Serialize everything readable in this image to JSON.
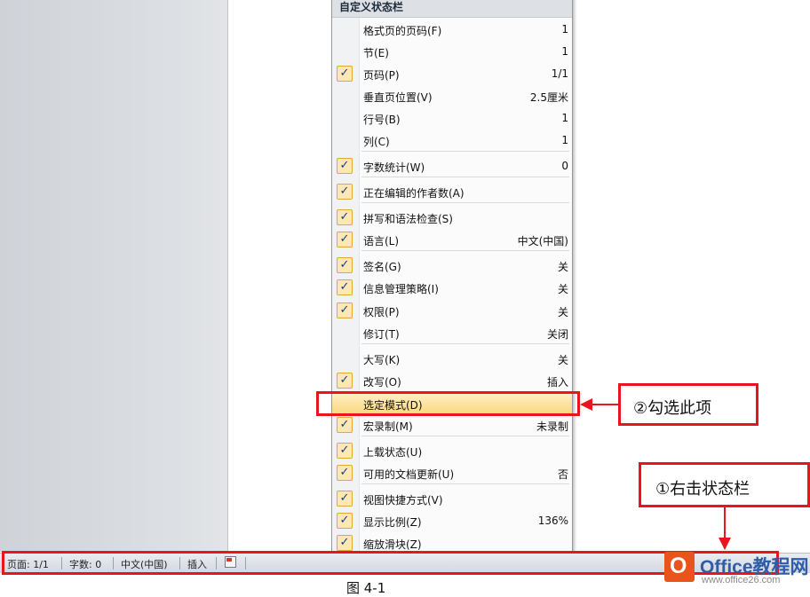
{
  "menu": {
    "title": "自定义状态栏",
    "items": [
      {
        "label": "格式页的页码(F)",
        "value": "1",
        "checked": false
      },
      {
        "label": "节(E)",
        "value": "1",
        "checked": false
      },
      {
        "label": "页码(P)",
        "value": "1/1",
        "checked": true
      },
      {
        "label": "垂直页位置(V)",
        "value": "2.5厘米",
        "checked": false
      },
      {
        "label": "行号(B)",
        "value": "1",
        "checked": false
      },
      {
        "label": "列(C)",
        "value": "1",
        "checked": false
      },
      {
        "label": "字数统计(W)",
        "value": "0",
        "checked": true
      },
      {
        "label": "正在编辑的作者数(A)",
        "value": "",
        "checked": true
      },
      {
        "label": "拼写和语法检查(S)",
        "value": "",
        "checked": true
      },
      {
        "label": "语言(L)",
        "value": "中文(中国)",
        "checked": true
      },
      {
        "label": "签名(G)",
        "value": "关",
        "checked": true
      },
      {
        "label": "信息管理策略(I)",
        "value": "关",
        "checked": true
      },
      {
        "label": "权限(P)",
        "value": "关",
        "checked": true
      },
      {
        "label": "修订(T)",
        "value": "关闭",
        "checked": false
      },
      {
        "label": "大写(K)",
        "value": "关",
        "checked": false
      },
      {
        "label": "改写(O)",
        "value": "插入",
        "checked": true
      },
      {
        "label": "选定模式(D)",
        "value": "",
        "checked": false
      },
      {
        "label": "宏录制(M)",
        "value": "未录制",
        "checked": true
      },
      {
        "label": "上载状态(U)",
        "value": "",
        "checked": true
      },
      {
        "label": "可用的文档更新(U)",
        "value": "否",
        "checked": true
      },
      {
        "label": "视图快捷方式(V)",
        "value": "",
        "checked": true
      },
      {
        "label": "显示比例(Z)",
        "value": "136%",
        "checked": true
      },
      {
        "label": "缩放滑块(Z)",
        "value": "",
        "checked": true
      }
    ]
  },
  "check_glyph": "✓",
  "statusbar": {
    "page": "页面: 1/1",
    "words": "字数: 0",
    "language": "中文(中国)",
    "mode": "插入"
  },
  "annotations": {
    "step1": "①右击状态栏",
    "step2": "②勾选此项"
  },
  "caption": "图 4-1",
  "logo": {
    "icon_letter": "O",
    "name": "Office教程网",
    "url": "www.office26.com"
  },
  "colors": {
    "annotation_red": "#e8141e",
    "highlight": "#fbd981",
    "check_border": "#e3a73b"
  }
}
